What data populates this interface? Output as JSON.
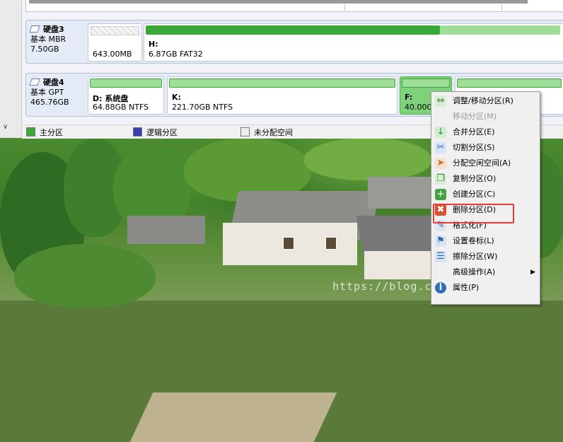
{
  "disks": [
    {
      "name": "硬盘3",
      "type": "基本 MBR",
      "size": "7.50GB",
      "partitions": [
        {
          "label": "",
          "size": "643.00MB ...",
          "kind": "unallocated"
        },
        {
          "label": "H:",
          "size": "6.87GB FAT32",
          "kind": "primary",
          "used": 0.74
        }
      ]
    },
    {
      "name": "硬盘4",
      "type": "基本 GPT",
      "size": "465.76GB",
      "partitions": [
        {
          "label": "D: 系统盘",
          "size": "64.88GB NTFS",
          "kind": "primary",
          "used": 1.0
        },
        {
          "label": "K:",
          "size": "221.70GB NTFS",
          "kind": "primary",
          "used": 1.0
        },
        {
          "label": "F:",
          "size": "40.00GB",
          "kind": "primary",
          "selected": true
        },
        {
          "label": "",
          "size": "",
          "kind": "primary"
        }
      ]
    }
  ],
  "legend": [
    {
      "label": "主分区",
      "color": "#3ba93a"
    },
    {
      "label": "逻辑分区",
      "color": "#3b3bb5"
    },
    {
      "label": "未分配空间",
      "color": "#eeeeee"
    }
  ],
  "context_menu": {
    "items": [
      {
        "label": "调整/移动分区(R)",
        "icon": "resize-icon",
        "enabled": true
      },
      {
        "label": "移动分区(M)",
        "icon": "",
        "enabled": false
      },
      {
        "label": "合并分区(E)",
        "icon": "merge-icon",
        "enabled": true
      },
      {
        "label": "切割分区(S)",
        "icon": "split-icon",
        "enabled": true
      },
      {
        "label": "分配空闲空间(A)",
        "icon": "allocate-icon",
        "enabled": true
      },
      {
        "label": "复制分区(O)",
        "icon": "copy-icon",
        "enabled": true
      },
      {
        "label": "创建分区(C)",
        "icon": "create-icon",
        "enabled": true
      },
      {
        "label": "删除分区(D)",
        "icon": "delete-icon",
        "enabled": true,
        "highlighted": true
      },
      {
        "label": "格式化(F)",
        "icon": "format-icon",
        "enabled": true
      },
      {
        "label": "设置卷标(L)",
        "icon": "label-icon",
        "enabled": true
      },
      {
        "label": "擦除分区(W)",
        "icon": "wipe-icon",
        "enabled": true
      },
      {
        "label": "高级操作(A)",
        "icon": "",
        "enabled": true,
        "submenu": true
      },
      {
        "label": "属性(P)",
        "icon": "info-icon",
        "enabled": true
      }
    ]
  },
  "watermark": "https://blog.csdn.net/Xeon_CC",
  "colors": {
    "primary": "#3ba93a",
    "logical": "#3b3bb5",
    "highlight": "#e43b36"
  }
}
